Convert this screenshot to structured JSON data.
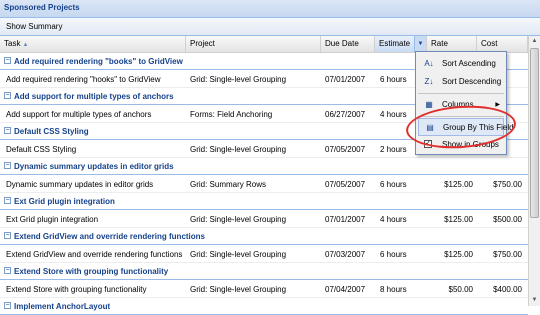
{
  "panel": {
    "title": "Sponsored Projects"
  },
  "toolbar": {
    "show_summary": "Show Summary"
  },
  "columns": {
    "task": "Task",
    "project": "Project",
    "due_date": "Due Date",
    "estimate": "Estimate",
    "rate": "Rate",
    "cost": "Cost"
  },
  "groups": [
    {
      "title": "Add required rendering \"books\" to GridView",
      "row": {
        "task": "Add required rendering \"hooks\" to GridView",
        "project": "Grid: Single-level Grouping",
        "due": "07/01/2007",
        "estimate": "6 hours",
        "rate": "",
        "cost": ""
      }
    },
    {
      "title": "Add support for multiple types of anchors",
      "row": {
        "task": "Add support for multiple types of anchors",
        "project": "Forms: Field Anchoring",
        "due": "06/27/2007",
        "estimate": "4 hours",
        "rate": "",
        "cost": ""
      }
    },
    {
      "title": "Default CSS Styling",
      "row": {
        "task": "Default CSS Styling",
        "project": "Grid: Single-level Grouping",
        "due": "07/05/2007",
        "estimate": "2 hours",
        "rate": "",
        "cost": ""
      }
    },
    {
      "title": "Dynamic summary updates in editor grids",
      "row": {
        "task": "Dynamic summary updates in editor grids",
        "project": "Grid: Summary Rows",
        "due": "07/05/2007",
        "estimate": "6 hours",
        "rate": "$125.00",
        "cost": "$750.00"
      }
    },
    {
      "title": "Ext Grid plugin integration",
      "row": {
        "task": "Ext Grid plugin integration",
        "project": "Grid: Single-level Grouping",
        "due": "07/01/2007",
        "estimate": "4 hours",
        "rate": "$125.00",
        "cost": "$500.00"
      }
    },
    {
      "title": "Extend GridView and override rendering functions",
      "row": {
        "task": "Extend GridView and override rendering functions",
        "project": "Grid: Single-level Grouping",
        "due": "07/03/2007",
        "estimate": "6 hours",
        "rate": "$125.00",
        "cost": "$750.00"
      }
    },
    {
      "title": "Extend Store with grouping functionality",
      "row": {
        "task": "Extend Store with grouping functionality",
        "project": "Grid: Single-level Grouping",
        "due": "07/04/2007",
        "estimate": "8 hours",
        "rate": "$50.00",
        "cost": "$400.00"
      }
    },
    {
      "title": "Implement AnchorLayout",
      "row": null
    }
  ],
  "menu": {
    "sort_asc": "Sort Ascending",
    "sort_desc": "Sort Descending",
    "columns": "Columns",
    "group_by": "Group By This Field",
    "show_in_groups": "Show in Groups"
  },
  "icons": {
    "sort_asc": "sort-ascending-icon",
    "sort_desc": "sort-descending-icon",
    "columns": "columns-icon",
    "group_by": "group-by-icon"
  },
  "colors": {
    "group_title": "#15428b",
    "header_border": "#99bbe8",
    "annotation": "#e0302e",
    "menu_highlight": "#dfe8f6"
  }
}
